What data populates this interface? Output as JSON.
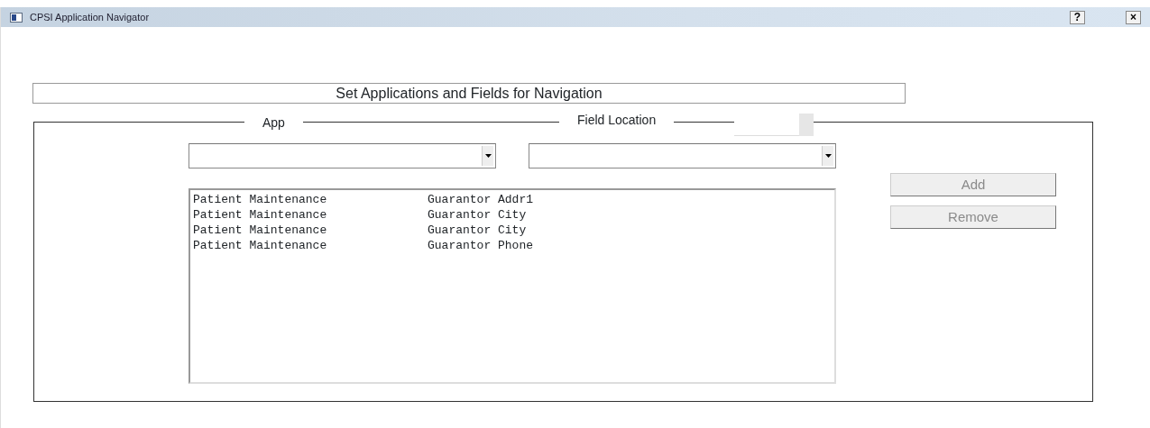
{
  "window": {
    "title": "CPSI Application Navigator",
    "buttons": [
      "?",
      "×"
    ]
  },
  "heading": "Set Applications and Fields for Navigation",
  "group": {
    "app_label": "App",
    "field_label": "Field Location"
  },
  "list": {
    "rows": [
      {
        "app": "Patient Maintenance",
        "field": "Guarantor Addr1"
      },
      {
        "app": "Patient Maintenance",
        "field": "Guarantor City"
      },
      {
        "app": "Patient Maintenance",
        "field": "Guarantor City"
      },
      {
        "app": "Patient Maintenance",
        "field": "Guarantor Phone"
      }
    ]
  },
  "buttons": [
    {
      "label": "Add",
      "disabled": true
    },
    {
      "label": "Remove",
      "disabled": true
    }
  ]
}
